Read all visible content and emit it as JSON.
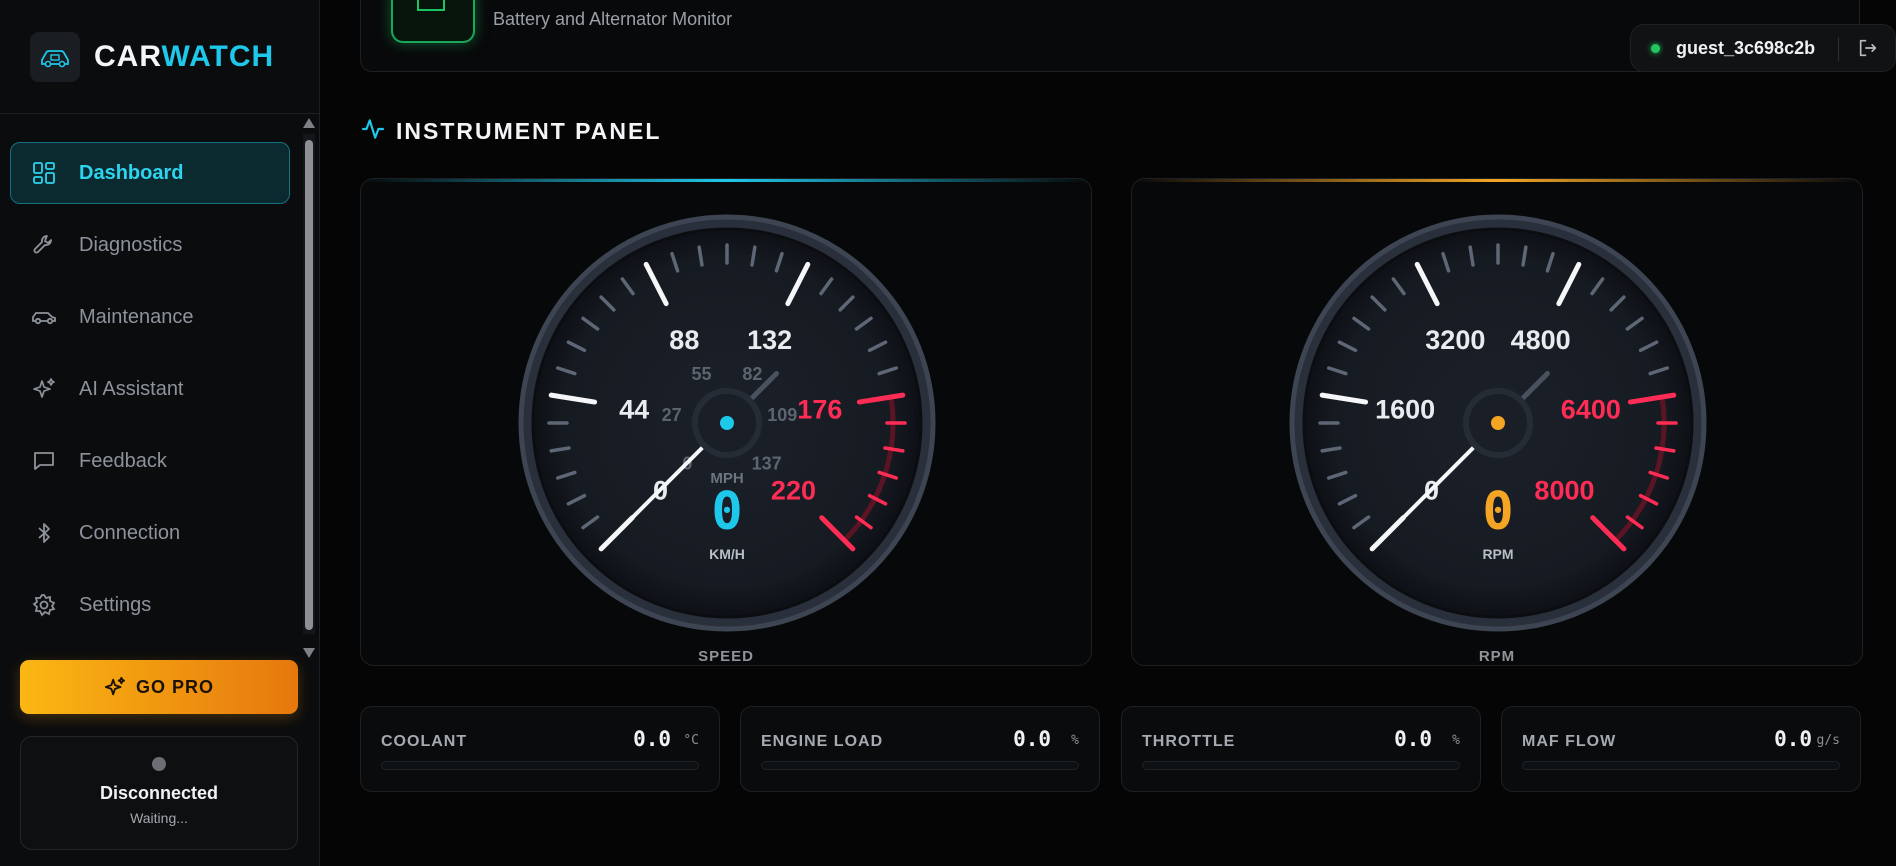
{
  "brand": {
    "name_a": "CAR",
    "name_b": "WATCH",
    "logo_icon": "car-chip-icon"
  },
  "sidebar": {
    "items": [
      {
        "label": "Dashboard",
        "icon": "grid-icon",
        "active": true
      },
      {
        "label": "Diagnostics",
        "icon": "wrench-icon"
      },
      {
        "label": "Maintenance",
        "icon": "car-icon"
      },
      {
        "label": "AI Assistant",
        "icon": "sparkles-icon"
      },
      {
        "label": "Feedback",
        "icon": "chat-icon"
      },
      {
        "label": "Connection",
        "icon": "bluetooth-icon"
      },
      {
        "label": "Settings",
        "icon": "gear-icon"
      }
    ],
    "go_pro_label": "GO PRO",
    "connection": {
      "status": "Disconnected",
      "sub": "Waiting..."
    }
  },
  "header": {
    "subtitle": "Battery and Alternator Monitor",
    "user": "guest_3c698c2b"
  },
  "section_title": "INSTRUMENT PANEL",
  "gauges": {
    "speed": {
      "label": "SPEED",
      "unit": "KM/H",
      "unit_secondary": "MPH",
      "value": "0",
      "max": 220,
      "accent": "#1ec8ea",
      "major_labels": [
        "0",
        "44",
        "88",
        "132",
        "176",
        "220"
      ],
      "minor_labels": [
        "0",
        "27",
        "55",
        "82",
        "109",
        "137"
      ],
      "redline_from": 176
    },
    "rpm": {
      "label": "RPM",
      "unit": "RPM",
      "value": "0",
      "max": 8000,
      "accent": "#f5a524",
      "major_labels": [
        "0",
        "1600",
        "3200",
        "4800",
        "6400",
        "8000"
      ],
      "redline_from": 6400
    }
  },
  "metrics": [
    {
      "name": "COOLANT",
      "value": "0.0",
      "unit": "°C"
    },
    {
      "name": "ENGINE LOAD",
      "value": "0.0",
      "unit": "%"
    },
    {
      "name": "THROTTLE",
      "value": "0.0",
      "unit": "%"
    },
    {
      "name": "MAF FLOW",
      "value": "0.0",
      "unit": "g/s"
    }
  ],
  "colors": {
    "accent_cyan": "#1ec8ea",
    "accent_amber": "#f5a524",
    "redline": "#ff2d55",
    "status_green": "#22c55e"
  }
}
